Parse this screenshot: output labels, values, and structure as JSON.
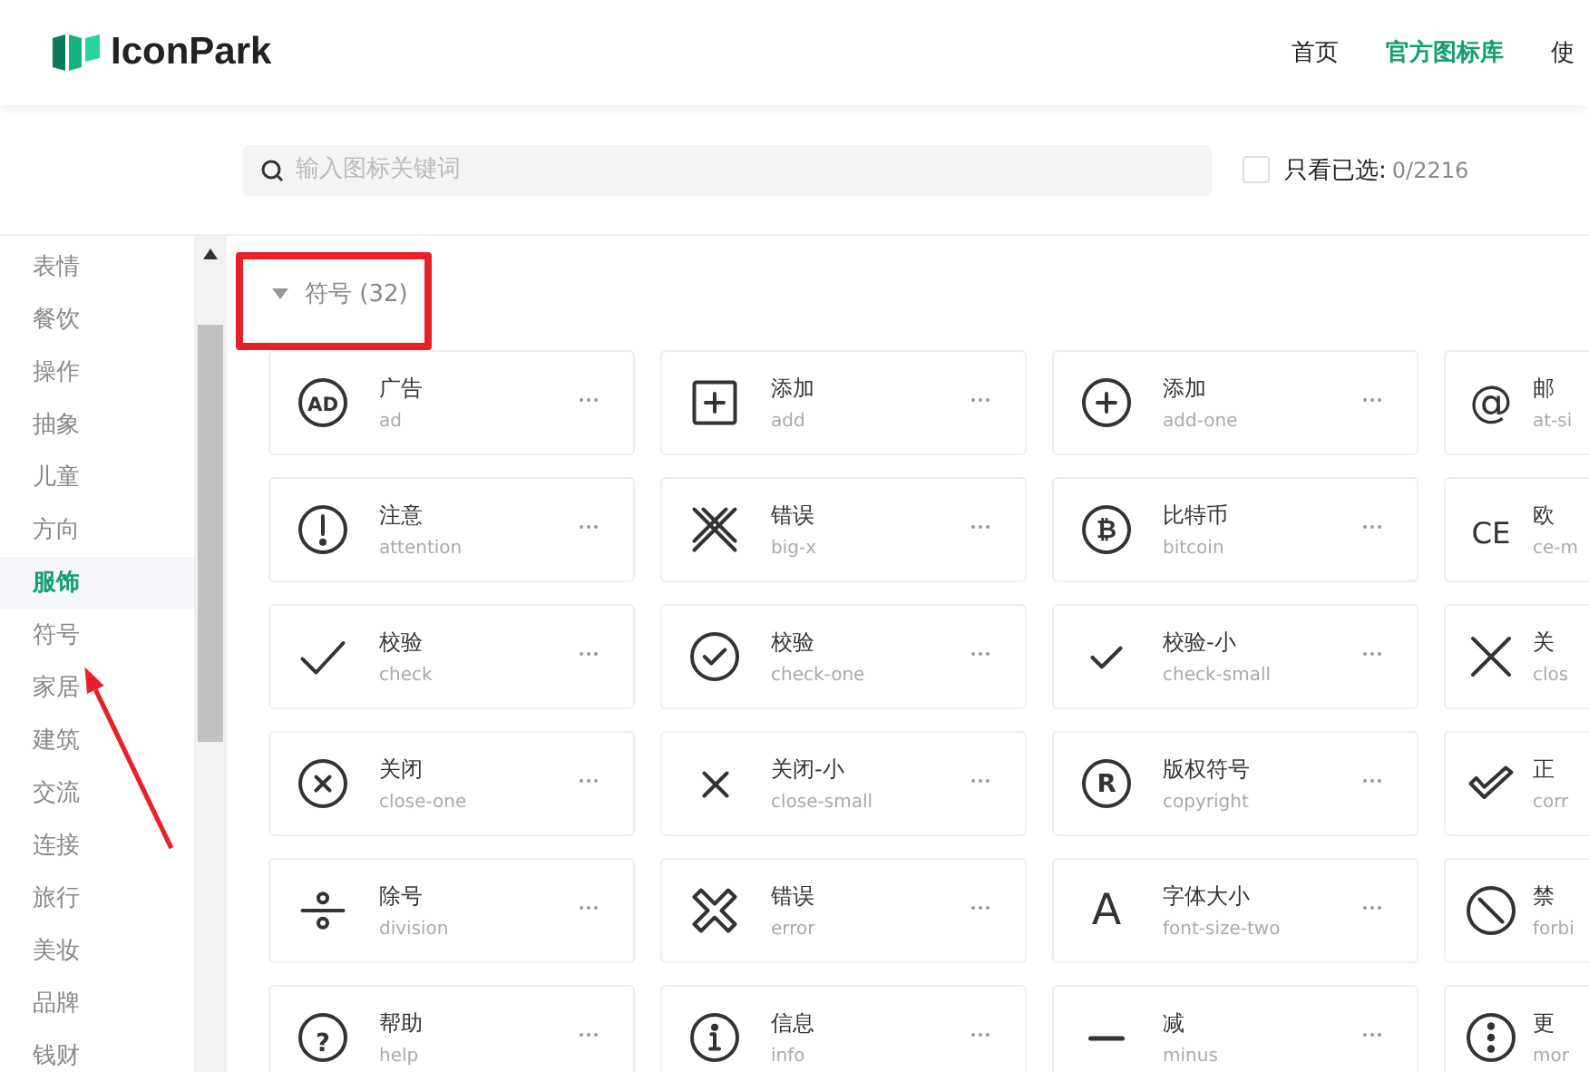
{
  "header": {
    "logo": "IconPark",
    "nav": [
      {
        "label": "首页",
        "selected": false
      },
      {
        "label": "官方图标库",
        "selected": true
      },
      {
        "label": "使",
        "selected": false
      }
    ]
  },
  "search": {
    "placeholder": "输入图标关键词",
    "only_selected": {
      "label": "只看已选:",
      "count": "0/2216",
      "checked": false
    }
  },
  "sidebar": {
    "items": [
      {
        "label": "表情",
        "selected": false
      },
      {
        "label": "餐饮",
        "selected": false
      },
      {
        "label": "操作",
        "selected": false
      },
      {
        "label": "抽象",
        "selected": false
      },
      {
        "label": "儿童",
        "selected": false
      },
      {
        "label": "方向",
        "selected": false
      },
      {
        "label": "服饰",
        "selected": true
      },
      {
        "label": "符号",
        "selected": false
      },
      {
        "label": "家居",
        "selected": false
      },
      {
        "label": "建筑",
        "selected": false
      },
      {
        "label": "交流",
        "selected": false
      },
      {
        "label": "连接",
        "selected": false
      },
      {
        "label": "旅行",
        "selected": false
      },
      {
        "label": "美妆",
        "selected": false
      },
      {
        "label": "品牌",
        "selected": false
      },
      {
        "label": "钱财",
        "selected": false
      }
    ]
  },
  "section": {
    "title": "符号 (32)",
    "expanded": true,
    "icons": [
      {
        "kind": "ad",
        "icon_text": "AD",
        "title": "广告",
        "name": "ad"
      },
      {
        "kind": "add",
        "title": "添加",
        "name": "add"
      },
      {
        "kind": "add-one",
        "title": "添加",
        "name": "add-one"
      },
      {
        "kind": "at",
        "icon_text": "@",
        "title": "邮",
        "name": "at-si"
      },
      {
        "kind": "attention",
        "title": "注意",
        "name": "attention"
      },
      {
        "kind": "big-x",
        "title": "错误",
        "name": "big-x"
      },
      {
        "kind": "bitcoin",
        "icon_text": "₿",
        "title": "比特币",
        "name": "bitcoin"
      },
      {
        "kind": "ce",
        "icon_text": "CE",
        "title": "欧",
        "name": "ce-m"
      },
      {
        "kind": "check",
        "title": "校验",
        "name": "check"
      },
      {
        "kind": "check-one",
        "title": "校验",
        "name": "check-one"
      },
      {
        "kind": "check-small",
        "title": "校验-小",
        "name": "check-small"
      },
      {
        "kind": "close",
        "title": "关",
        "name": "clos"
      },
      {
        "kind": "close-one",
        "title": "关闭",
        "name": "close-one"
      },
      {
        "kind": "close-small",
        "title": "关闭-小",
        "name": "close-small"
      },
      {
        "kind": "copyright",
        "icon_text": "R",
        "title": "版权符号",
        "name": "copyright"
      },
      {
        "kind": "correct",
        "title": "正",
        "name": "corr"
      },
      {
        "kind": "division",
        "title": "除号",
        "name": "division"
      },
      {
        "kind": "error",
        "title": "错误",
        "name": "error"
      },
      {
        "kind": "font-size",
        "icon_text": "A",
        "title": "字体大小",
        "name": "font-size-two"
      },
      {
        "kind": "forbid",
        "title": "禁",
        "name": "forbi"
      },
      {
        "kind": "help",
        "icon_text": "?",
        "title": "帮助",
        "name": "help"
      },
      {
        "kind": "info",
        "title": "信息",
        "name": "info"
      },
      {
        "kind": "minus",
        "title": "减",
        "name": "minus"
      },
      {
        "kind": "more",
        "title": "更",
        "name": "mor"
      }
    ]
  }
}
